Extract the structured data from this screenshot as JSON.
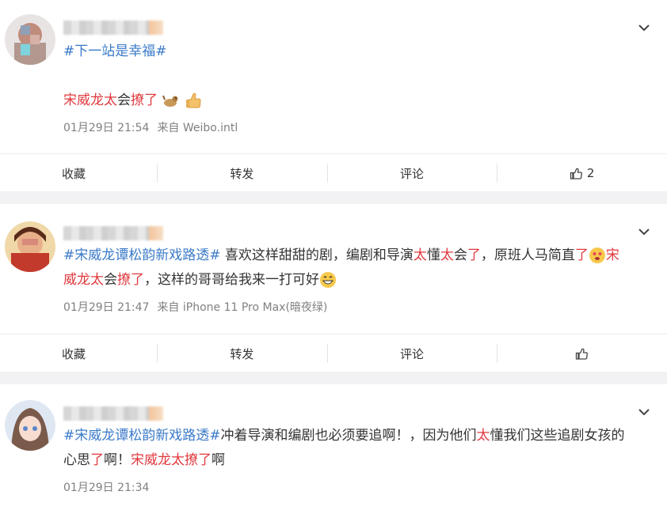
{
  "posts": [
    {
      "topic": "#下一站是幸福#",
      "segments": [
        {
          "t": "宋威龙太",
          "c": "red"
        },
        {
          "t": "会",
          "c": ""
        },
        {
          "t": "撩了",
          "c": "red"
        }
      ],
      "emojis": [
        "dog-icon",
        "thumbs-up-icon"
      ],
      "time": "01月29日 21:54",
      "source": "来自 Weibo.intl",
      "actions": {
        "collect": "收藏",
        "repost": "转发",
        "comment": "评论",
        "like_count": "2"
      }
    },
    {
      "line1": [
        {
          "t": "#宋威龙谭松韵新戏路透#",
          "c": "topic"
        },
        {
          "t": " 喜欢这样甜甜的剧，编剧和导演",
          "c": ""
        },
        {
          "t": "太",
          "c": "red"
        },
        {
          "t": "懂",
          "c": ""
        },
        {
          "t": "太",
          "c": "red"
        },
        {
          "t": "会",
          "c": ""
        },
        {
          "t": "了",
          "c": "red"
        },
        {
          "t": "，原班人马简直",
          "c": ""
        },
        {
          "t": "了",
          "c": "red"
        }
      ],
      "line1_end": {
        "t": "宋",
        "c": "red"
      },
      "line2": [
        {
          "t": "威龙太",
          "c": "red"
        },
        {
          "t": "会",
          "c": ""
        },
        {
          "t": "撩了",
          "c": "red"
        },
        {
          "t": "，这样的哥哥给我来一打可好",
          "c": ""
        }
      ],
      "time": "01月29日 21:47",
      "source": "来自 iPhone 11 Pro Max(暗夜绿)",
      "actions": {
        "collect": "收藏",
        "repost": "转发",
        "comment": "评论"
      }
    },
    {
      "line1": [
        {
          "t": "#宋威龙谭松韵新戏路透#",
          "c": "topic"
        },
        {
          "t": "冲着导演和编剧也必须要追啊！，因为他们",
          "c": ""
        },
        {
          "t": "太",
          "c": "red"
        },
        {
          "t": "懂我们这些追剧女孩的",
          "c": ""
        }
      ],
      "line2": [
        {
          "t": "心思",
          "c": ""
        },
        {
          "t": "了",
          "c": "red"
        },
        {
          "t": "啊！",
          "c": ""
        },
        {
          "t": "宋威龙太撩了",
          "c": "red"
        },
        {
          "t": "啊",
          "c": ""
        }
      ],
      "time": "01月29日 21:34"
    }
  ],
  "colors": {
    "topic": "#3a7ac8",
    "highlight": "#e0393e",
    "meta": "#808080",
    "divider": "#f2f2f5"
  }
}
